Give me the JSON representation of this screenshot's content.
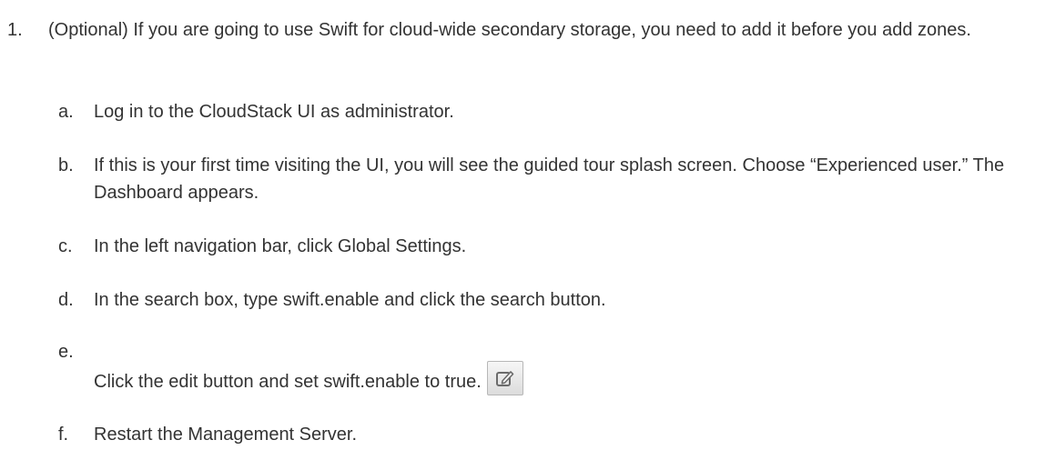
{
  "step": {
    "number": "1.",
    "text": "(Optional) If you are going to use Swift for cloud-wide secondary storage, you need to add it before you add zones."
  },
  "substeps": [
    {
      "label": "a.",
      "text": "Log in to the CloudStack UI as administrator."
    },
    {
      "label": "b.",
      "text": "If this is your first time visiting the UI, you will see the guided tour splash screen. Choose “Experienced user.” The Dashboard appears."
    },
    {
      "label": "c.",
      "text": "In the left navigation bar, click Global Settings."
    },
    {
      "label": "d.",
      "text": "In the search box, type swift.enable and click the search button."
    },
    {
      "label": "e.",
      "text": "Click the edit button and set swift.enable to true."
    },
    {
      "label": "f.",
      "text": "Restart the Management Server."
    }
  ],
  "icons": {
    "edit": "edit-icon"
  },
  "colors": {
    "text": "#333333",
    "icon_stroke": "#6b6b6b"
  }
}
